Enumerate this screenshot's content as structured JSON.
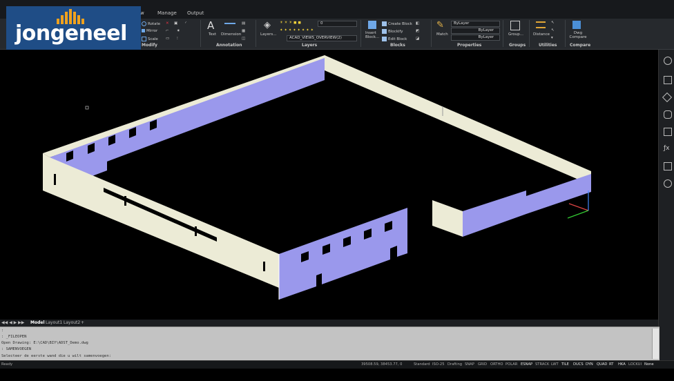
{
  "menu": {
    "view_partial": "w",
    "manage": "Manage",
    "output": "Output"
  },
  "logo": {
    "text": "jongeneel"
  },
  "ribbon": {
    "modify": {
      "title": "Modify",
      "rotate": "Rotate",
      "mirror": "Mirror",
      "scale": "Scale"
    },
    "annotation": {
      "title": "Annotation",
      "text": "Text",
      "dimension": "Dimension"
    },
    "layers": {
      "title": "Layers",
      "layers_button": "Layers...",
      "current_layer": "0",
      "view_layer": "ACAD_VIEWS_OVERVIEW(2)"
    },
    "blocks": {
      "title": "Blocks",
      "insert": "Insert Block...",
      "create": "Create Block",
      "blockify": "Blockify",
      "edit": "Edit Block"
    },
    "properties": {
      "title": "Properties",
      "match": "Match",
      "color": "ByLayer",
      "linetype": "ByLayer",
      "lineweight": "ByLayer"
    },
    "groups": {
      "title": "Groups",
      "group": "Group..."
    },
    "utilities": {
      "title": "Utilities",
      "distance": "Distance"
    },
    "compare": {
      "title": "Compare",
      "dwg_compare": "Dwg Compare"
    }
  },
  "layout_tabs": {
    "model": "Model",
    "layout1": "Layout1",
    "layout2": "Layout2",
    "add": "+"
  },
  "command_history": [
    ":",
    ": _FILEOPEN",
    "Open Drawing: E:\\CAD\\BIY\\ADST_Demo.dwg",
    ": SAMENVOEGEN",
    "Selecteer de eerste wand die u wilt samenvoegen:"
  ],
  "status": {
    "ready": "Ready",
    "coords": "39508.59, 38453.77, 0",
    "style": "Standard",
    "iso": "ISO-25",
    "workspace": "Drafting",
    "toggles": [
      "SNAP",
      "GRID",
      "ORTHO",
      "POLAR",
      "ESNAP",
      "STRACK",
      "LWT",
      "TILE",
      "DUCS",
      "DYN",
      "QUAD",
      "RT",
      "HKA",
      "LOCKUI",
      "None"
    ],
    "active_toggles": [
      "ESNAP",
      "TILE",
      "DUCS",
      "DYN",
      "QUAD",
      "RT",
      "HKA",
      "None"
    ]
  },
  "colors": {
    "wall_top": "#ecebd6",
    "wall_face": "#9a98ec",
    "ribbon_bg": "#26292d",
    "logo_bg": "#1f4d86",
    "logo_accent": "#f0a21e"
  }
}
